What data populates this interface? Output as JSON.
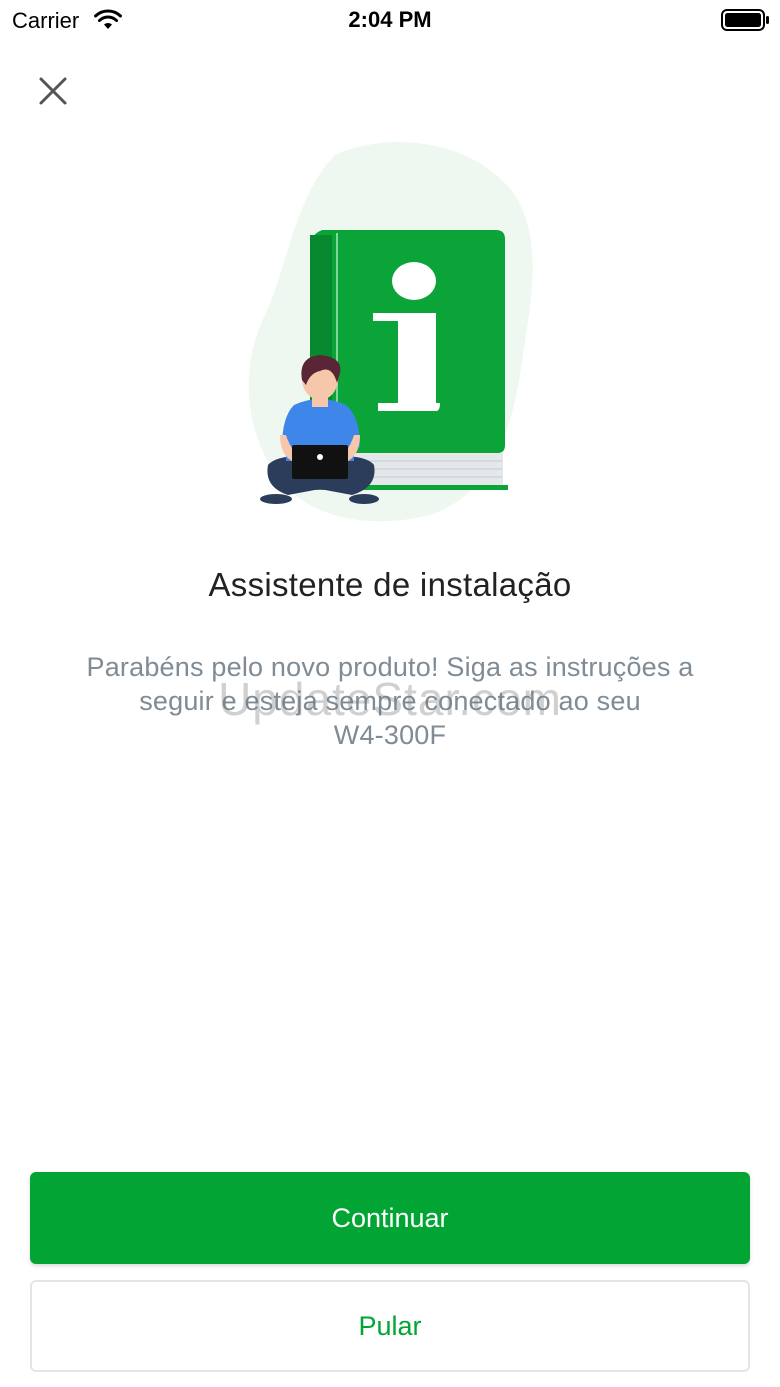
{
  "status_bar": {
    "carrier": "Carrier",
    "time": "2:04 PM",
    "wifi_icon": "wifi-icon",
    "battery_icon": "battery-full-icon"
  },
  "header": {
    "close_icon": "close-icon"
  },
  "illustration": {
    "icon": "info-book-illustration",
    "book_color": "#0aa439",
    "blob_color": "#eef8f0"
  },
  "content": {
    "title": "Assistente de instalação",
    "description_lines": [
      "Parabéns pelo novo produto! Siga as instruções a",
      "seguir e esteja sempre conectado ao seu",
      "W4-300F"
    ]
  },
  "watermark": "UpdateStar.com",
  "actions": {
    "continue_label": "Continuar",
    "skip_label": "Pular"
  },
  "colors": {
    "accent": "#02a534",
    "text_secondary": "#7f8b95"
  }
}
